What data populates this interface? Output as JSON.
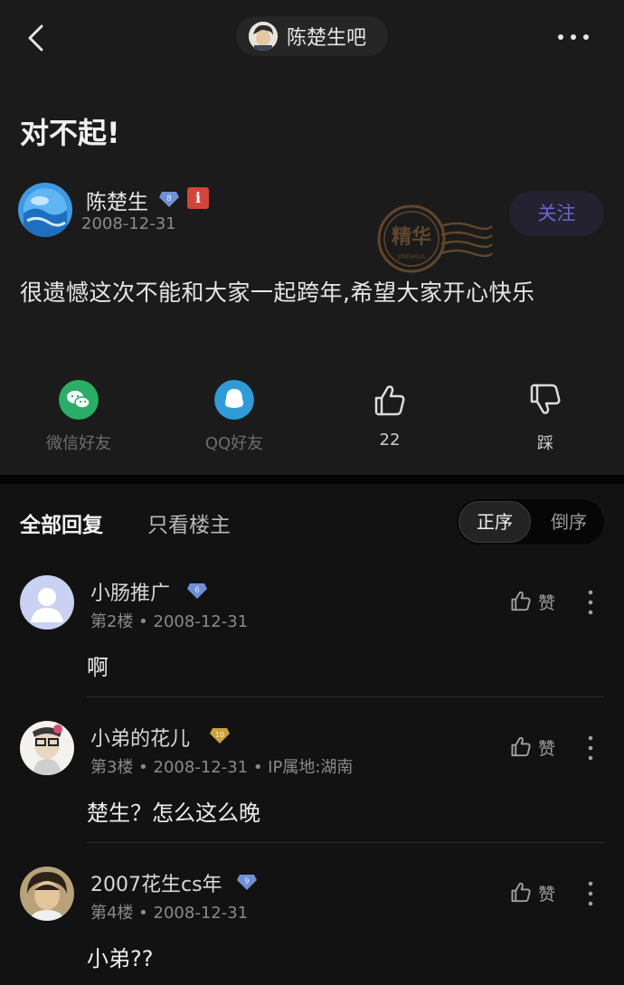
{
  "topbar": {
    "forum_name": "陈楚生吧",
    "icons": {
      "back": "chevron-left-icon",
      "more": "more-dots-icon"
    }
  },
  "post": {
    "title": "对不起!",
    "author": {
      "name": "陈楚生",
      "level": "8",
      "date": "2008-12-31"
    },
    "follow_label": "关注",
    "stamp_text": {
      "main": "精华",
      "sub": "JINGHUA"
    },
    "body": "很遗憾这次不能和大家一起跨年,希望大家开心快乐",
    "share": [
      {
        "label": "微信好友",
        "icon": "wechat-icon"
      },
      {
        "label": "QQ好友",
        "icon": "qq-icon"
      },
      {
        "label": "22",
        "icon": "thumbs-up-icon"
      },
      {
        "label": "踩",
        "icon": "thumbs-down-icon"
      }
    ]
  },
  "replies_header": {
    "tab_all": "全部回复",
    "tab_op": "只看楼主",
    "sort_asc": "正序",
    "sort_desc": "倒序"
  },
  "replies": [
    {
      "name": "小肠推广",
      "level": "6",
      "meta": "第2楼 • 2008-12-31",
      "like_label": "赞",
      "text": "啊"
    },
    {
      "name": "小弟的花儿",
      "level": "10",
      "meta": "第3楼 • 2008-12-31 • IP属地:湖南",
      "like_label": "赞",
      "text": "楚生？怎么这么晚"
    },
    {
      "name": "2007花生cs年",
      "level": "9",
      "meta": "第4楼 • 2008-12-31",
      "like_label": "赞",
      "text": "小弟??"
    }
  ],
  "colors": {
    "background": "#121212",
    "card": "#1b1b1b",
    "accent_purple": "#6c63d8",
    "badge_blue": "#6f8fd6",
    "badge_gold": "#c9a23c",
    "wechat_green": "#2aae67",
    "qq_blue": "#2f9bd9"
  }
}
